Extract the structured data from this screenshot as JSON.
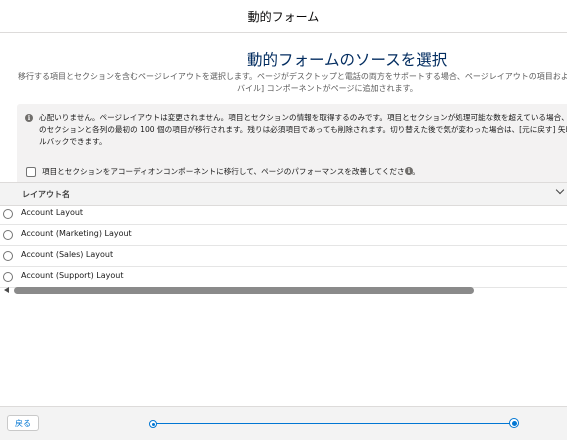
{
  "modal": {
    "title": "動的フォーム"
  },
  "main": {
    "heading": "動的フォームのソースを選択",
    "description_line1": "移行する項目とセクションを含むページレイアウトを選択します。ページがデスクトップと電話の両方をサポートする場合、ページレイアウトの項目およびセクションと",
    "description_line2": "バイル] コンポーネントがページに追加されます。"
  },
  "info": {
    "icon": "info-icon",
    "line1": "心配いりません。ページレイアウトは変更されません。項目とセクションの情報を取得するのみです。項目とセクションが処理可能な数を超えている場合、最大で",
    "line2": "のセクションと各列の最初の 100 個の項目が移行されます。残りは必須項目であっても削除されます。切り替えた後で気が変わった場合は、[元に戻す] 矢印をクリ",
    "line3": "ルバックできます。",
    "checkbox_label": "項目とセクションをアコーディオンコンポーネントに移行して、ページのパフォーマンスを改善してください。",
    "checkbox_checked": false,
    "help_icon": "info-icon"
  },
  "table": {
    "column_header": "レイアウト名",
    "rows": [
      {
        "label": "Account Layout",
        "selected": false
      },
      {
        "label": "Account (Marketing) Layout",
        "selected": false
      },
      {
        "label": "Account (Sales) Layout",
        "selected": false
      },
      {
        "label": "Account (Support) Layout",
        "selected": false
      }
    ]
  },
  "footer": {
    "back_label": "戻る",
    "progress": {
      "current_step": 1,
      "total_steps": 2
    }
  },
  "colors": {
    "accent": "#0176d3",
    "heading": "#032d60",
    "info_background": "#f3f2f2"
  }
}
